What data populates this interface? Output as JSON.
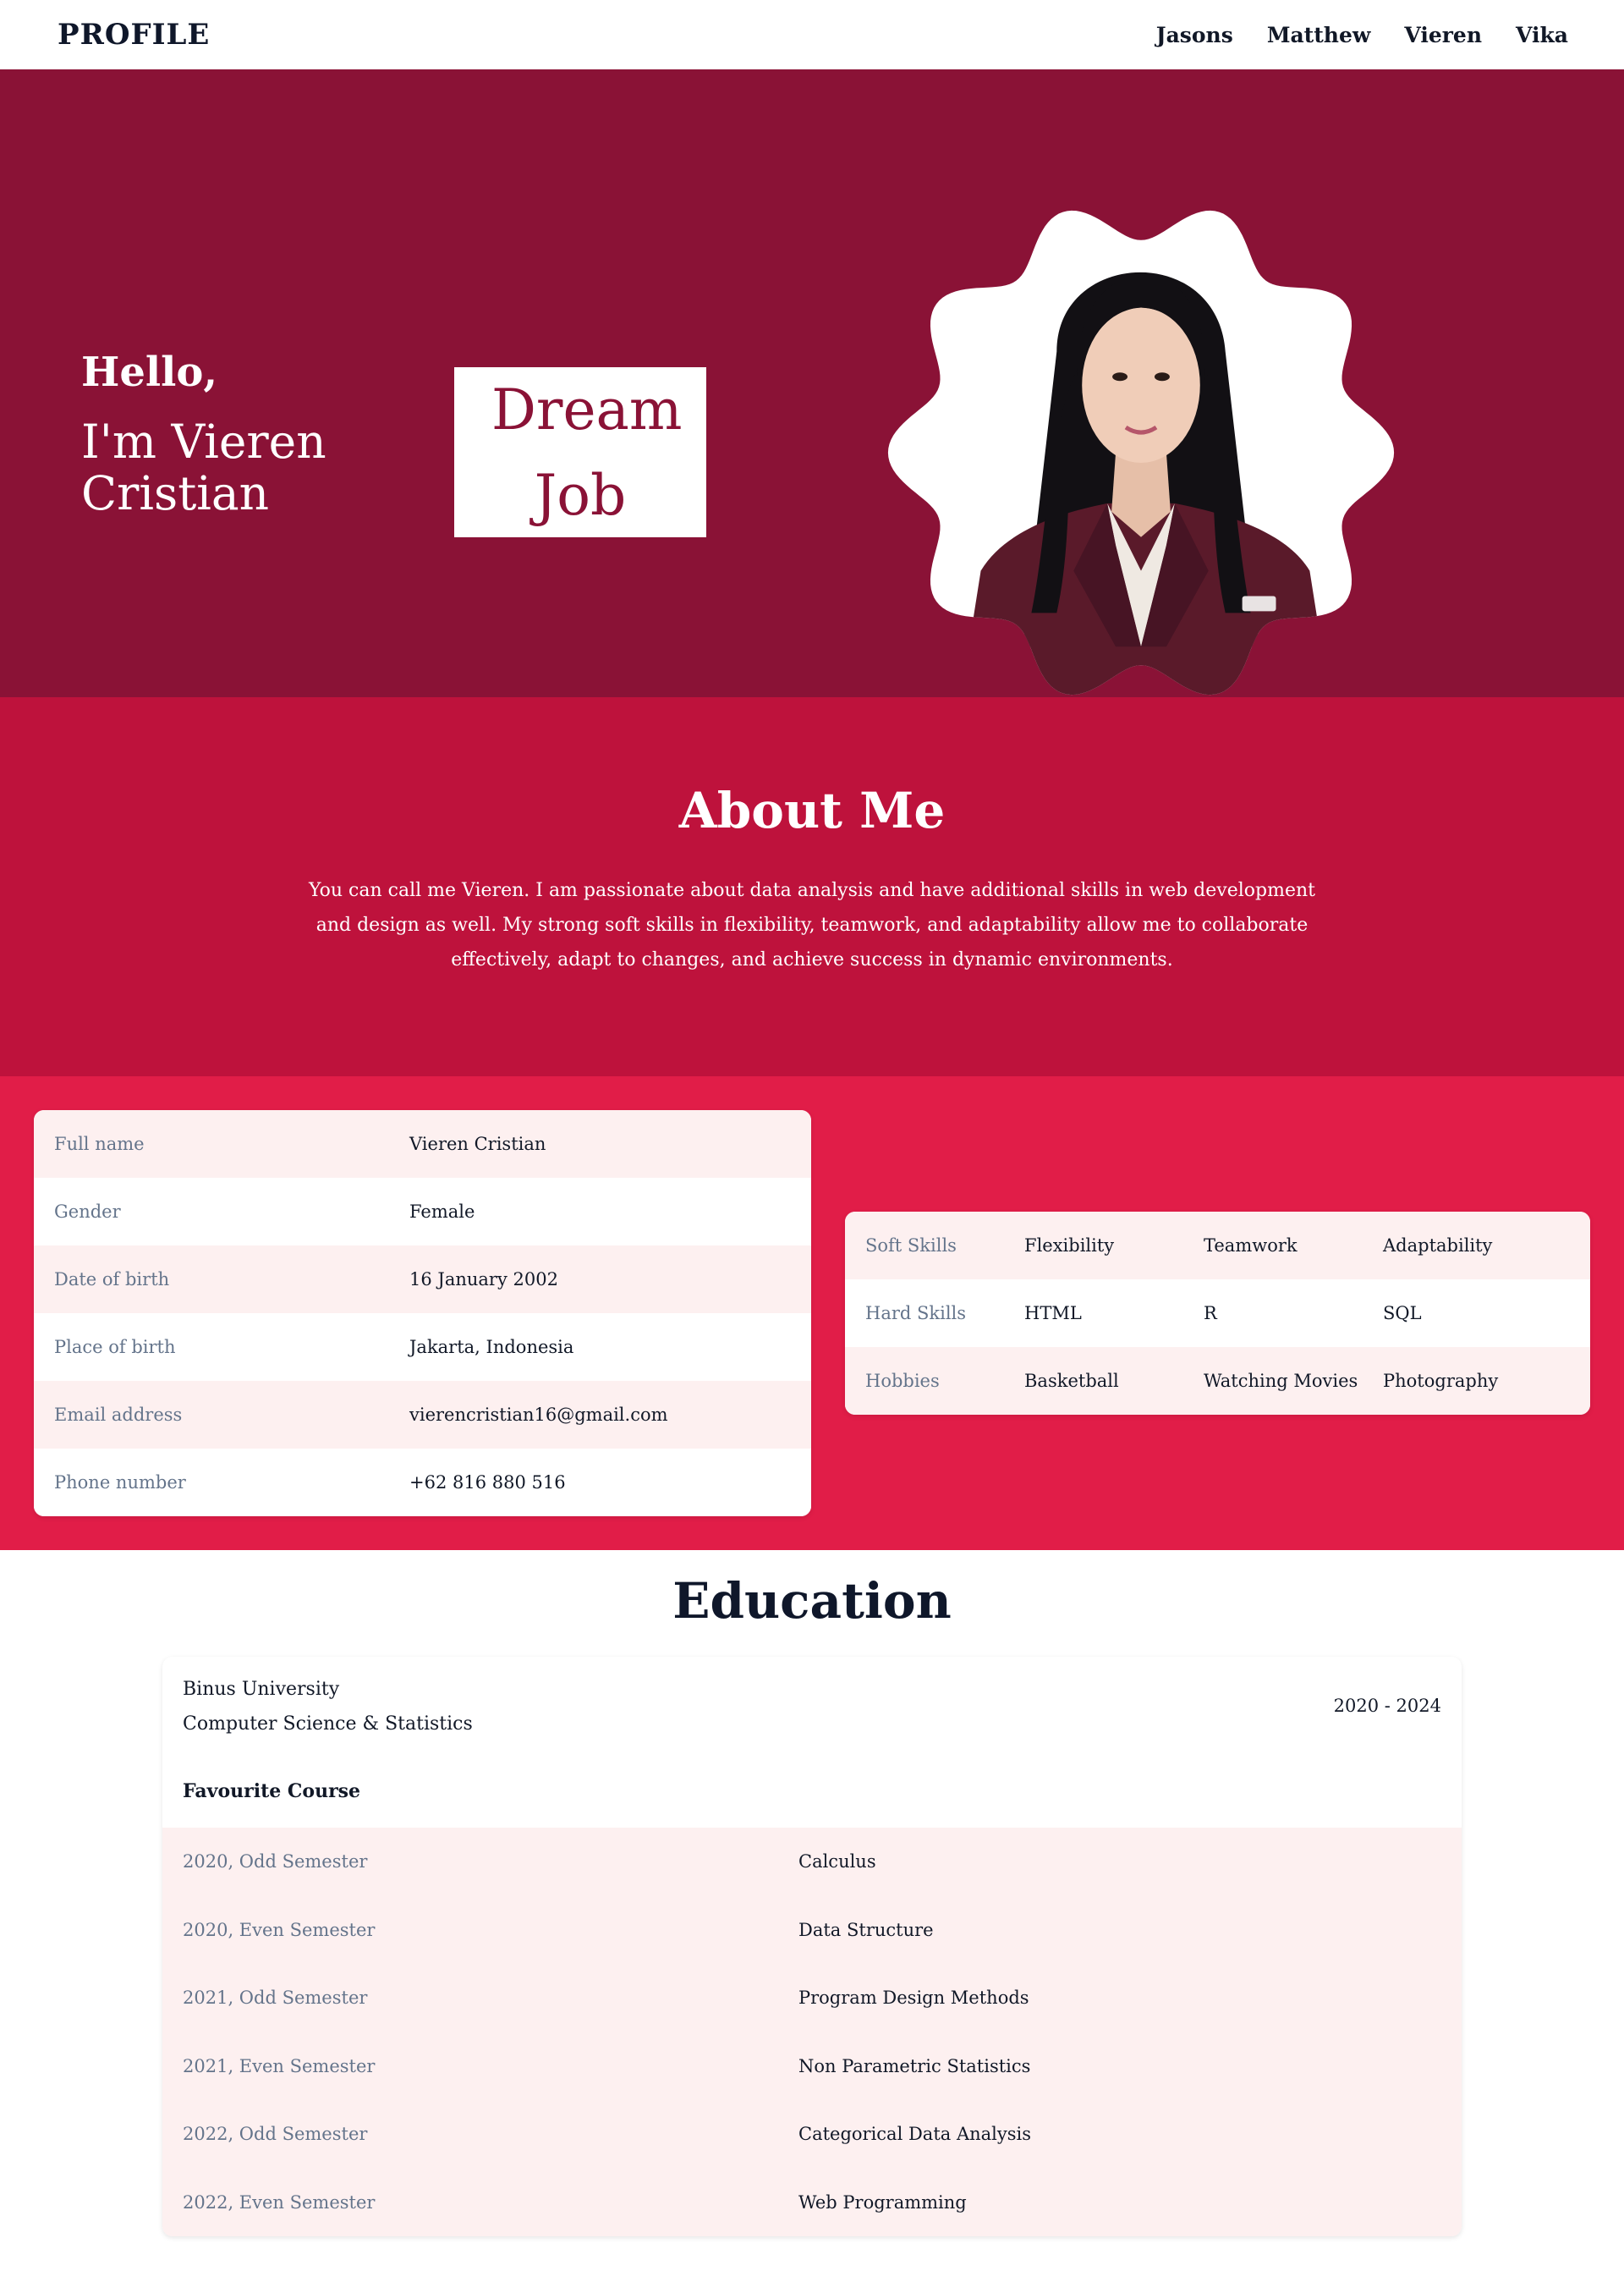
{
  "nav": {
    "brand": "PROFILE",
    "links": [
      "Jasons",
      "Matthew",
      "Vieren",
      "Vika"
    ]
  },
  "hero": {
    "greeting": "Hello,",
    "name": "I'm Vieren Cristian",
    "dream_line1": "Dream",
    "dream_line2": "Job"
  },
  "about": {
    "title": "About Me",
    "text": "You can call me Vieren. I am passionate about data analysis and have additional skills in web development and design as well. My strong soft skills in flexibility, teamwork, and adaptability allow me to collaborate effectively, adapt to changes, and achieve success in dynamic environments."
  },
  "personal": [
    {
      "label": "Full name",
      "value": "Vieren Cristian"
    },
    {
      "label": "Gender",
      "value": "Female"
    },
    {
      "label": "Date of birth",
      "value": "16 January 2002"
    },
    {
      "label": "Place of birth",
      "value": "Jakarta, Indonesia"
    },
    {
      "label": "Email address",
      "value": "vierencristian16@gmail.com"
    },
    {
      "label": "Phone number",
      "value": "+62 816 880 516"
    }
  ],
  "skills": [
    {
      "label": "Soft Skills",
      "values": [
        "Flexibility",
        "Teamwork",
        "Adaptability"
      ]
    },
    {
      "label": "Hard Skills",
      "values": [
        "HTML",
        "R",
        "SQL"
      ]
    },
    {
      "label": "Hobbies",
      "values": [
        "Basketball",
        "Watching Movies",
        "Photography"
      ]
    }
  ],
  "education": {
    "title": "Education",
    "university": "Binus University",
    "major": "Computer Science & Statistics",
    "years": "2020 - 2024",
    "favourite_title": "Favourite Course",
    "courses": [
      {
        "semester": "2020, Odd Semester",
        "course": "Calculus"
      },
      {
        "semester": "2020, Even Semester",
        "course": "Data Structure"
      },
      {
        "semester": "2021, Odd Semester",
        "course": "Program Design Methods"
      },
      {
        "semester": "2021, Even Semester",
        "course": "Non Parametric Statistics"
      },
      {
        "semester": "2022, Odd Semester",
        "course": "Categorical Data Analysis"
      },
      {
        "semester": "2022, Even Semester",
        "course": "Web Programming"
      }
    ]
  },
  "colors": {
    "hero_bg": "#8a1236",
    "about_bg": "#be123c",
    "details_bg": "#e11d48",
    "row_tint": "#fdf0f0",
    "jacket": "#5a1a2a"
  },
  "icons": {
    "profile_photo": "portrait-photo-in-wavy-frame"
  }
}
